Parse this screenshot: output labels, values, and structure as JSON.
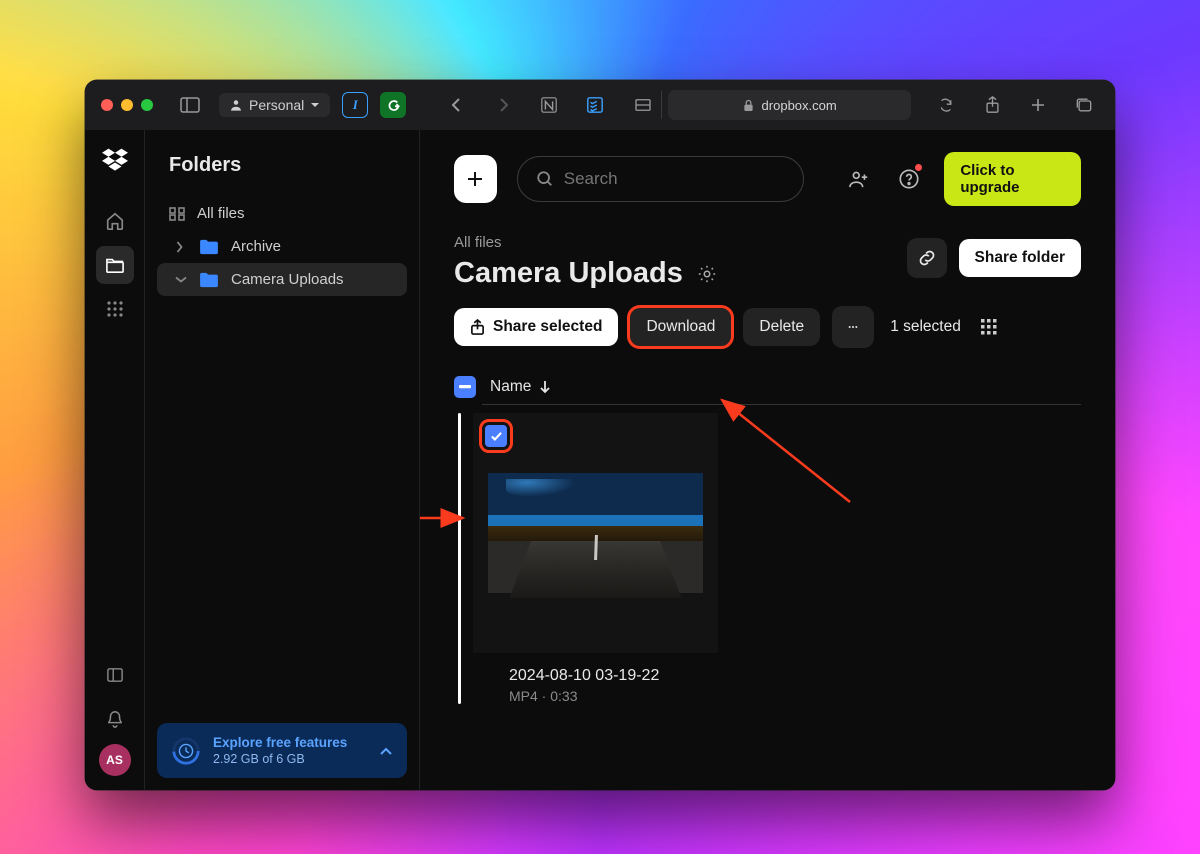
{
  "browser": {
    "profile": "Personal",
    "domain": "dropbox.com"
  },
  "rail": {
    "avatar": "AS"
  },
  "sidebar": {
    "title": "Folders",
    "all_files": "All files",
    "items": [
      {
        "label": "Archive"
      },
      {
        "label": "Camera Uploads"
      }
    ],
    "promo": {
      "title": "Explore free features",
      "sub": "2.92 GB of 6 GB"
    }
  },
  "main": {
    "search_placeholder": "Search",
    "upgrade": "Click to upgrade",
    "breadcrumb": "All files",
    "title": "Camera Uploads",
    "share_folder": "Share folder",
    "share_selected": "Share selected",
    "download": "Download",
    "delete": "Delete",
    "selected": "1 selected",
    "col_name": "Name",
    "file": {
      "name": "2024-08-10 03-19-22",
      "meta": "MP4 · 0:33"
    }
  }
}
